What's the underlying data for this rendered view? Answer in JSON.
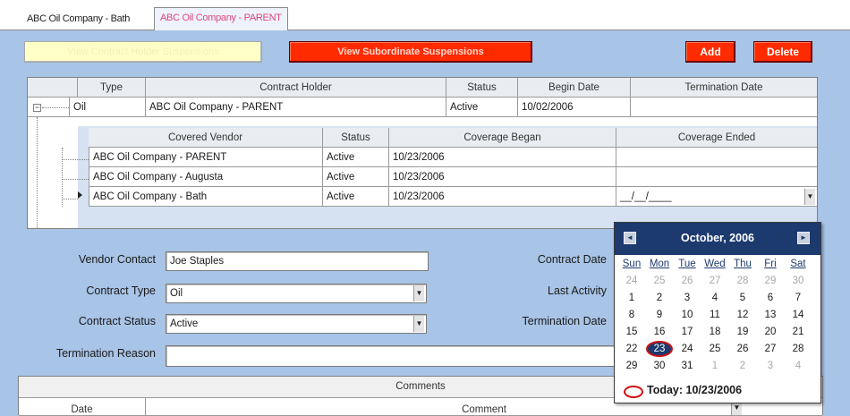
{
  "tabs": [
    {
      "label": "ABC Oil Company - Bath",
      "active": false
    },
    {
      "label": "ABC Oil Company - PARENT",
      "active": true
    }
  ],
  "buttons": {
    "view_holder": "View Contract Holder Suspensions",
    "view_subordinate": "View Subordinate Suspensions",
    "add": "Add",
    "delete": "Delete"
  },
  "contract_grid": {
    "columns": [
      "Type",
      "Contract Holder",
      "Status",
      "Begin Date",
      "Termination Date"
    ],
    "row": {
      "type": "Oil",
      "holder": "ABC Oil Company - PARENT",
      "status": "Active",
      "begin": "10/02/2006",
      "termination": ""
    },
    "expander": "−"
  },
  "vendor_grid": {
    "columns": [
      "Covered Vendor",
      "Status",
      "Coverage Began",
      "Coverage Ended"
    ],
    "rows": [
      {
        "vendor": "ABC Oil Company - PARENT",
        "status": "Active",
        "began": "10/23/2006",
        "ended": ""
      },
      {
        "vendor": "ABC Oil Company - Augusta",
        "status": "Active",
        "began": "10/23/2006",
        "ended": ""
      },
      {
        "vendor": "ABC Oil Company - Bath",
        "status": "Active",
        "began": "10/23/2006",
        "ended": "__/__/____"
      }
    ]
  },
  "form": {
    "vendor_contact_label": "Vendor Contact",
    "vendor_contact_value": "Joe Staples",
    "contract_type_label": "Contract Type",
    "contract_type_value": "Oil",
    "contract_status_label": "Contract Status",
    "contract_status_value": "Active",
    "termination_reason_label": "Termination Reason",
    "termination_reason_value": "",
    "contract_date_label": "Contract Date",
    "last_activity_label": "Last Activity",
    "termination_date_label": "Termination Date"
  },
  "comments": {
    "title": "Comments",
    "col_date": "Date",
    "col_comment": "Comment"
  },
  "calendar": {
    "title": "October, 2006",
    "days_of_week": [
      "Sun",
      "Mon",
      "Tue",
      "Wed",
      "Thu",
      "Fri",
      "Sat"
    ],
    "weeks": [
      [
        "24",
        "25",
        "26",
        "27",
        "28",
        "29",
        "30"
      ],
      [
        "1",
        "2",
        "3",
        "4",
        "5",
        "6",
        "7"
      ],
      [
        "8",
        "9",
        "10",
        "11",
        "12",
        "13",
        "14"
      ],
      [
        "15",
        "16",
        "17",
        "18",
        "19",
        "20",
        "21"
      ],
      [
        "22",
        "23",
        "24",
        "25",
        "26",
        "27",
        "28"
      ],
      [
        "29",
        "30",
        "31",
        "1",
        "2",
        "3",
        "4"
      ]
    ],
    "other_month": [
      [
        true,
        true,
        true,
        true,
        true,
        true,
        true
      ],
      [
        false,
        false,
        false,
        false,
        false,
        false,
        false
      ],
      [
        false,
        false,
        false,
        false,
        false,
        false,
        false
      ],
      [
        false,
        false,
        false,
        false,
        false,
        false,
        false
      ],
      [
        false,
        false,
        false,
        false,
        false,
        false,
        false
      ],
      [
        false,
        false,
        false,
        true,
        true,
        true,
        true
      ]
    ],
    "selected": "23",
    "today_label": "Today: 10/23/2006",
    "prev_icon": "◄",
    "next_icon": "►"
  },
  "icons": {
    "dropdown": "▼"
  },
  "colors": {
    "background": "#a8c4e6",
    "button_red": "#ff2b00",
    "calendar_header": "#1c3a6e",
    "active_tab_text": "#e0457a"
  }
}
